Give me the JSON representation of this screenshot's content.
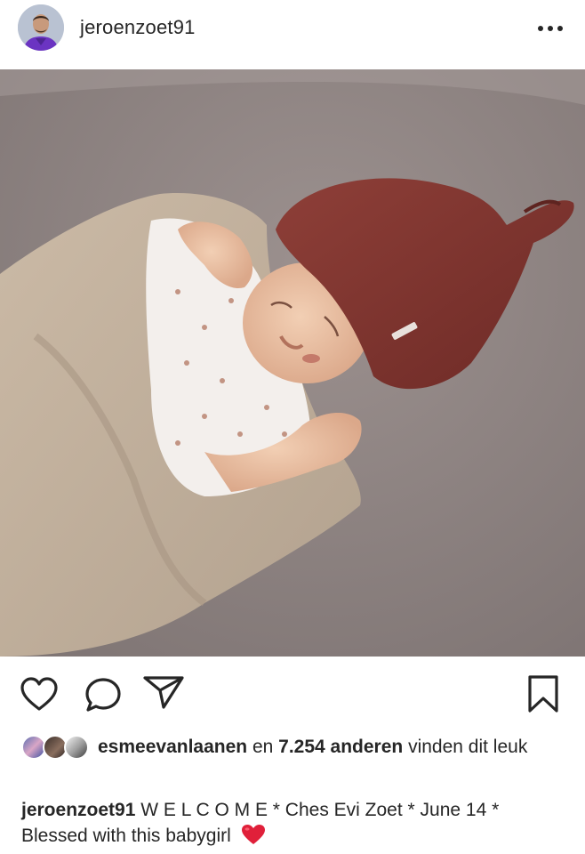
{
  "post": {
    "username": "jeroenzoet91"
  },
  "likes": {
    "liker": "esmeevanlaanen",
    "joiner": " en ",
    "count": "7.254 anderen",
    "suffix": " vinden dit leuk"
  },
  "caption": {
    "username": "jeroenzoet91",
    "text": " W E L C O M E * Ches Evi Zoet * June 14 * Blessed with this babygirl"
  },
  "icons": {
    "more": "more-options-icon",
    "like": "heart-outline-icon",
    "comment": "comment-bubble-icon",
    "share": "paper-plane-icon",
    "save": "bookmark-icon",
    "emoji": "red-heart-emoji"
  },
  "colors": {
    "text": "#262626",
    "emoji_heart": "#e0203a",
    "background": "#ffffff"
  }
}
